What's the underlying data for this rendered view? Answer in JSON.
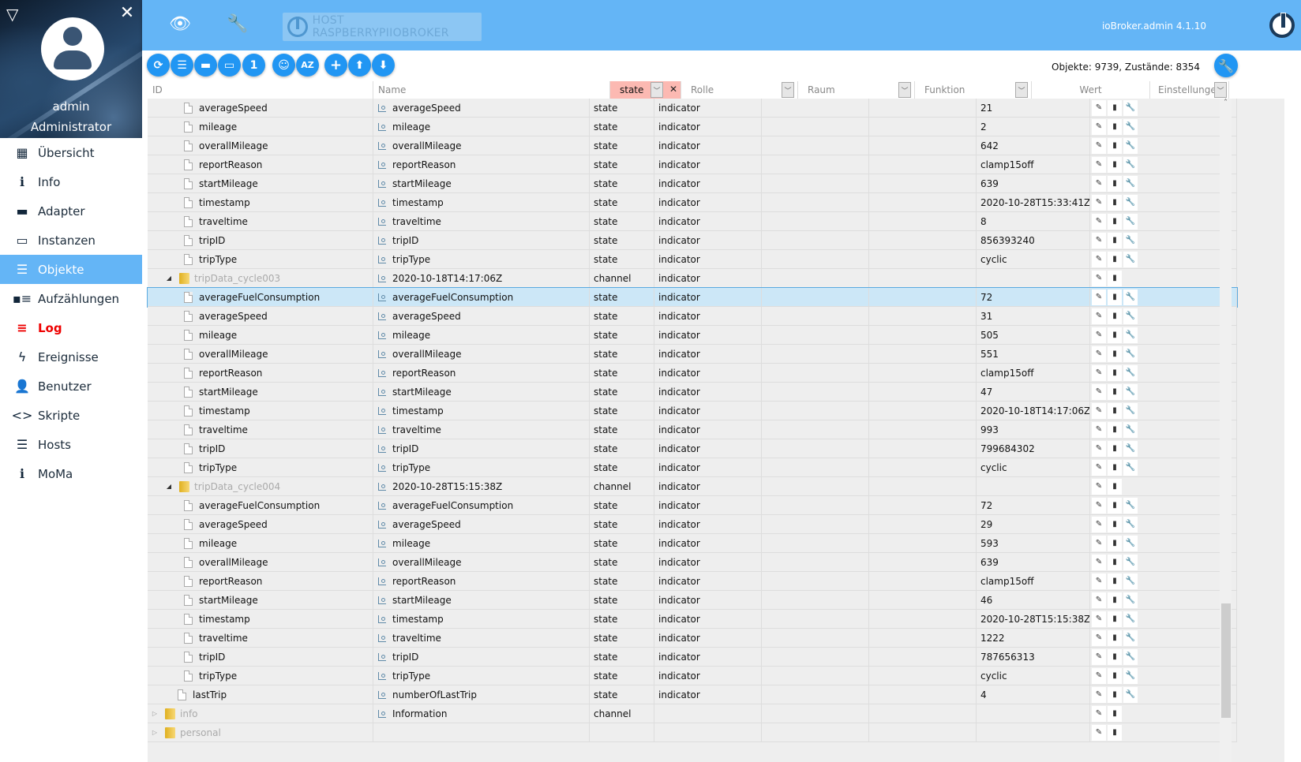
{
  "sidebar": {
    "user_name": "admin",
    "user_role": "Administrator",
    "items": [
      {
        "label": "Übersicht",
        "icon": "grid-icon",
        "glyph": "▦"
      },
      {
        "label": "Info",
        "icon": "info-icon",
        "glyph": "ℹ"
      },
      {
        "label": "Adapter",
        "icon": "store-icon",
        "glyph": "▬"
      },
      {
        "label": "Instanzen",
        "icon": "subtitles-icon",
        "glyph": "▭"
      },
      {
        "label": "Objekte",
        "icon": "list-icon",
        "glyph": "☰"
      },
      {
        "label": "Aufzählungen",
        "icon": "enum-icon",
        "glyph": "▪≡"
      },
      {
        "label": "Log",
        "icon": "log-icon",
        "glyph": "≡"
      },
      {
        "label": "Ereignisse",
        "icon": "flash-icon",
        "glyph": "ϟ"
      },
      {
        "label": "Benutzer",
        "icon": "person-icon",
        "glyph": "👤"
      },
      {
        "label": "Skripte",
        "icon": "code-icon",
        "glyph": "<>"
      },
      {
        "label": "Hosts",
        "icon": "dns-icon",
        "glyph": "☰"
      },
      {
        "label": "MoMa",
        "icon": "info-icon",
        "glyph": "ℹ"
      }
    ],
    "active": "Objekte"
  },
  "topbar": {
    "host": "HOST RASPBERRYPIIOBROKER",
    "version": "ioBroker.admin 4.1.10"
  },
  "toolbar": {
    "counts": "Objekte: 9739, Zustände: 8354"
  },
  "columns": {
    "id": "ID",
    "name": "Name",
    "type_filter": "state",
    "role": "Rolle",
    "room": "Raum",
    "function": "Funktion",
    "value": "Wert",
    "settings": "Einstellungen"
  },
  "rows": [
    {
      "id": "averageSpeed",
      "name": "averageSpeed",
      "type": "state",
      "role": "indicator",
      "value": "21",
      "kind": "state",
      "level": 2
    },
    {
      "id": "mileage",
      "name": "mileage",
      "type": "state",
      "role": "indicator",
      "value": "2",
      "kind": "state",
      "level": 2
    },
    {
      "id": "overallMileage",
      "name": "overallMileage",
      "type": "state",
      "role": "indicator",
      "value": "642",
      "kind": "state",
      "level": 2
    },
    {
      "id": "reportReason",
      "name": "reportReason",
      "type": "state",
      "role": "indicator",
      "value": "clamp15off",
      "kind": "state",
      "level": 2
    },
    {
      "id": "startMileage",
      "name": "startMileage",
      "type": "state",
      "role": "indicator",
      "value": "639",
      "kind": "state",
      "level": 2
    },
    {
      "id": "timestamp",
      "name": "timestamp",
      "type": "state",
      "role": "indicator",
      "value": "2020-10-28T15:33:41Z",
      "kind": "state",
      "level": 2
    },
    {
      "id": "traveltime",
      "name": "traveltime",
      "type": "state",
      "role": "indicator",
      "value": "8",
      "kind": "state",
      "level": 2
    },
    {
      "id": "tripID",
      "name": "tripID",
      "type": "state",
      "role": "indicator",
      "value": "856393240",
      "kind": "state",
      "level": 2
    },
    {
      "id": "tripType",
      "name": "tripType",
      "type": "state",
      "role": "indicator",
      "value": "cyclic",
      "kind": "state",
      "level": 2
    },
    {
      "id": "tripData_cycle003",
      "name": "2020-10-18T14:17:06Z",
      "type": "channel",
      "role": "indicator",
      "value": "",
      "kind": "channel",
      "level": 1,
      "expanded": true
    },
    {
      "id": "averageFuelConsumption",
      "name": "averageFuelConsumption",
      "type": "state",
      "role": "indicator",
      "value": "72",
      "kind": "state",
      "level": 2,
      "selected": true
    },
    {
      "id": "averageSpeed",
      "name": "averageSpeed",
      "type": "state",
      "role": "indicator",
      "value": "31",
      "kind": "state",
      "level": 2
    },
    {
      "id": "mileage",
      "name": "mileage",
      "type": "state",
      "role": "indicator",
      "value": "505",
      "kind": "state",
      "level": 2
    },
    {
      "id": "overallMileage",
      "name": "overallMileage",
      "type": "state",
      "role": "indicator",
      "value": "551",
      "kind": "state",
      "level": 2
    },
    {
      "id": "reportReason",
      "name": "reportReason",
      "type": "state",
      "role": "indicator",
      "value": "clamp15off",
      "kind": "state",
      "level": 2
    },
    {
      "id": "startMileage",
      "name": "startMileage",
      "type": "state",
      "role": "indicator",
      "value": "47",
      "kind": "state",
      "level": 2
    },
    {
      "id": "timestamp",
      "name": "timestamp",
      "type": "state",
      "role": "indicator",
      "value": "2020-10-18T14:17:06Z",
      "kind": "state",
      "level": 2
    },
    {
      "id": "traveltime",
      "name": "traveltime",
      "type": "state",
      "role": "indicator",
      "value": "993",
      "kind": "state",
      "level": 2
    },
    {
      "id": "tripID",
      "name": "tripID",
      "type": "state",
      "role": "indicator",
      "value": "799684302",
      "kind": "state",
      "level": 2
    },
    {
      "id": "tripType",
      "name": "tripType",
      "type": "state",
      "role": "indicator",
      "value": "cyclic",
      "kind": "state",
      "level": 2
    },
    {
      "id": "tripData_cycle004",
      "name": "2020-10-28T15:15:38Z",
      "type": "channel",
      "role": "indicator",
      "value": "",
      "kind": "channel",
      "level": 1,
      "expanded": true
    },
    {
      "id": "averageFuelConsumption",
      "name": "averageFuelConsumption",
      "type": "state",
      "role": "indicator",
      "value": "72",
      "kind": "state",
      "level": 2
    },
    {
      "id": "averageSpeed",
      "name": "averageSpeed",
      "type": "state",
      "role": "indicator",
      "value": "29",
      "kind": "state",
      "level": 2
    },
    {
      "id": "mileage",
      "name": "mileage",
      "type": "state",
      "role": "indicator",
      "value": "593",
      "kind": "state",
      "level": 2
    },
    {
      "id": "overallMileage",
      "name": "overallMileage",
      "type": "state",
      "role": "indicator",
      "value": "639",
      "kind": "state",
      "level": 2
    },
    {
      "id": "reportReason",
      "name": "reportReason",
      "type": "state",
      "role": "indicator",
      "value": "clamp15off",
      "kind": "state",
      "level": 2
    },
    {
      "id": "startMileage",
      "name": "startMileage",
      "type": "state",
      "role": "indicator",
      "value": "46",
      "kind": "state",
      "level": 2
    },
    {
      "id": "timestamp",
      "name": "timestamp",
      "type": "state",
      "role": "indicator",
      "value": "2020-10-28T15:15:38Z",
      "kind": "state",
      "level": 2
    },
    {
      "id": "traveltime",
      "name": "traveltime",
      "type": "state",
      "role": "indicator",
      "value": "1222",
      "kind": "state",
      "level": 2
    },
    {
      "id": "tripID",
      "name": "tripID",
      "type": "state",
      "role": "indicator",
      "value": "787656313",
      "kind": "state",
      "level": 2
    },
    {
      "id": "tripType",
      "name": "tripType",
      "type": "state",
      "role": "indicator",
      "value": "cyclic",
      "kind": "state",
      "level": 2
    },
    {
      "id": "lastTrip",
      "name": "numberOfLastTrip",
      "type": "state",
      "role": "indicator",
      "value": "4",
      "kind": "state",
      "level": 1
    },
    {
      "id": "info",
      "name": "Information",
      "type": "channel",
      "role": "",
      "value": "",
      "kind": "channel",
      "level": 0,
      "expanded": false
    },
    {
      "id": "personal",
      "name": "",
      "type": "",
      "role": "",
      "value": "",
      "kind": "channel",
      "level": 0,
      "expanded": false
    }
  ]
}
